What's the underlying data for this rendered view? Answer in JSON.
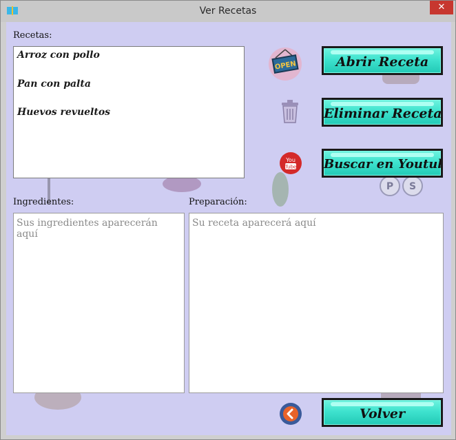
{
  "window": {
    "title": "Ver Recetas",
    "close_label": "✕"
  },
  "recetas": {
    "label": "Recetas:",
    "items": [
      "Arroz con pollo",
      "Pan con palta",
      "Huevos revueltos"
    ]
  },
  "ingredientes": {
    "label": "Ingredientes:",
    "placeholder": "Sus ingredientes aparecerán aquí"
  },
  "preparacion": {
    "label": "Preparación:",
    "placeholder": "Su receta aparecerá aquí"
  },
  "buttons": {
    "abrir": "Abrir Receta",
    "eliminar": "Eliminar Receta",
    "buscar": "Buscar en Youtube",
    "volver": "Volver"
  },
  "icons": {
    "open_sign": "OPEN",
    "youtube": "You Tube",
    "salt": "S",
    "pepper": "P",
    "back": "back-arrow-icon"
  },
  "colors": {
    "background": "#cfcdf2",
    "button": "#3fe3cf",
    "close": "#c7372f"
  }
}
